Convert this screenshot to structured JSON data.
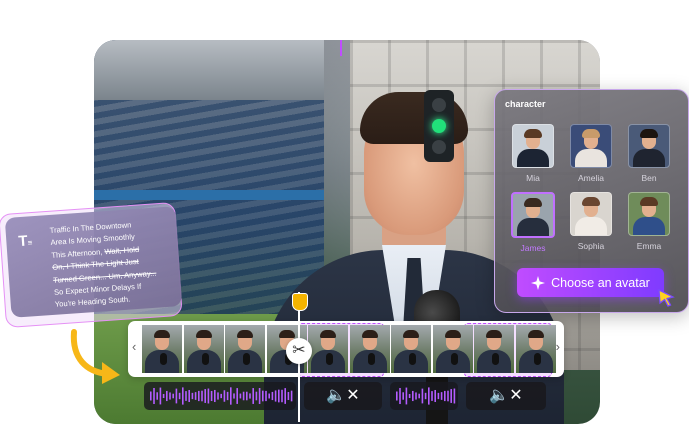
{
  "character_panel": {
    "title": "character",
    "avatars": [
      {
        "name": "Mia",
        "hair": "#5a3a24",
        "body": "#1c2433",
        "bg": "#c9d0d8",
        "selected": false
      },
      {
        "name": "Amelia",
        "hair": "#c89b6a",
        "body": "#e9e4df",
        "bg": "#3a4c78",
        "selected": false
      },
      {
        "name": "Ben",
        "hair": "#1c140f",
        "body": "#1f2430",
        "bg": "#4a5a78",
        "selected": false
      },
      {
        "name": "James",
        "hair": "#3a2a20",
        "body": "#262e3d",
        "bg": "#9aa4ad",
        "selected": true
      },
      {
        "name": "Sophia",
        "hair": "#6a4630",
        "body": "#f1ece6",
        "bg": "#d9d5cf",
        "selected": false
      },
      {
        "name": "Emma",
        "hair": "#5a3a24",
        "body": "#2f4f8a",
        "bg": "#6f8c5a",
        "selected": false
      }
    ],
    "choose_button_label": "Choose an avatar"
  },
  "text_card": {
    "icon": "text-icon",
    "lines": [
      {
        "text": "Traffic In The Downtown",
        "struck": false
      },
      {
        "text": "Area Is Moving Smoothly",
        "struck": false
      },
      {
        "text": "This Afternoon, ",
        "struck_part": "Wait, Hold"
      },
      {
        "text": "",
        "struck_part": "On, I Think The Light Just"
      },
      {
        "text": "",
        "struck_part": "Turned Green... Um, Anyway..."
      },
      {
        "text": "So Expect Minor Delays If",
        "struck": false
      },
      {
        "text": "You're Heading South.",
        "struck": false
      }
    ]
  },
  "timeline": {
    "prev_icon": "‹",
    "next_icon": "›",
    "scissors_icon": "✂",
    "mute_icon": "🔇"
  },
  "colors": {
    "accent": "#c04cff",
    "playhead_knob": "#f5b400",
    "waveform": "#b45cff"
  }
}
